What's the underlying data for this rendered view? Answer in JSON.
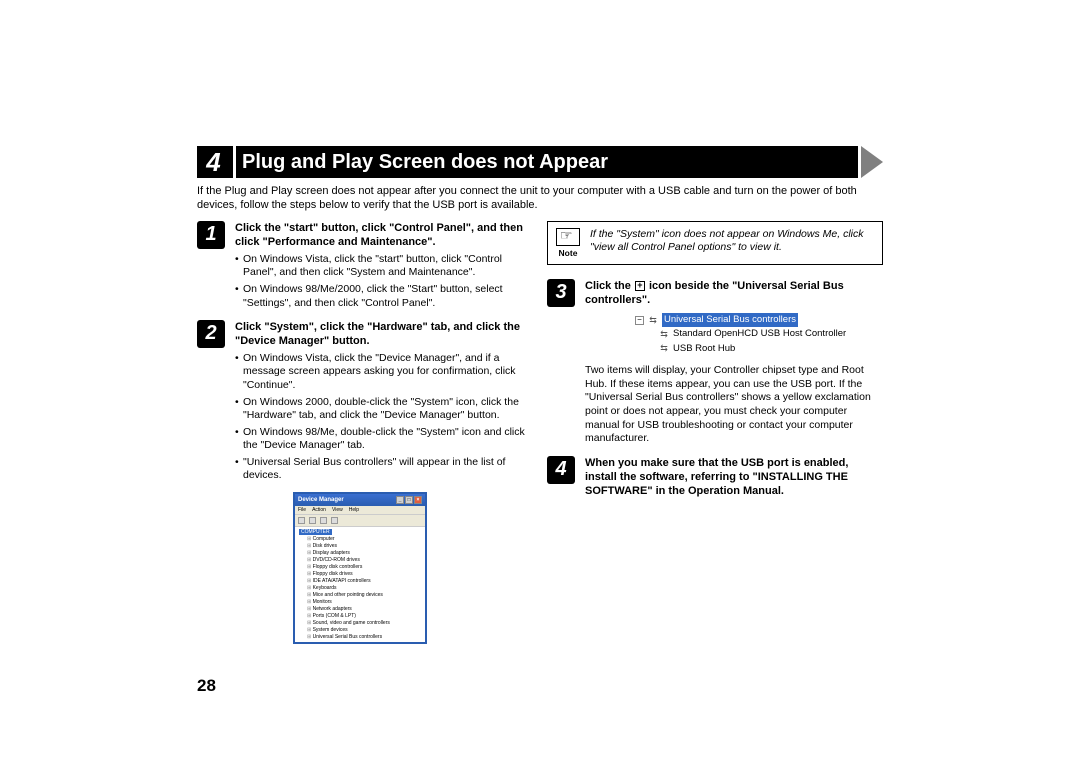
{
  "section_number": "4",
  "section_title": "Plug and Play Screen does not Appear",
  "intro": "If the Plug and Play screen does not appear after you connect the unit to your computer with a USB cable and turn on the power of both devices, follow the steps below to verify that the USB port is available.",
  "page_number": "28",
  "steps": {
    "s1": {
      "num": "1",
      "head": "Click the \"start\" button, click \"Control Panel\", and then click \"Performance and Maintenance\".",
      "bullets": [
        "On Windows Vista, click the \"start\" button, click \"Control Panel\", and then click \"System and Maintenance\".",
        "On Windows 98/Me/2000, click the \"Start\" button, select \"Settings\", and then click \"Control Panel\"."
      ]
    },
    "s2": {
      "num": "2",
      "head": "Click \"System\", click the \"Hardware\" tab, and click the \"Device Manager\" button.",
      "bullets": [
        "On Windows Vista, click the \"Device Manager\", and if a message screen appears asking you for confirmation, click \"Continue\".",
        "On Windows 2000, double-click the \"System\" icon, click the \"Hardware\" tab, and click the \"Device Manager\" button.",
        "On Windows 98/Me, double-click the \"System\" icon and click the \"Device Manager\" tab.",
        "\"Universal Serial Bus controllers\" will appear in the list of devices."
      ]
    },
    "s3": {
      "num": "3",
      "head_prefix": "Click the ",
      "head_suffix": " icon beside the \"Universal Serial Bus controllers\".",
      "body": "Two items will display, your Controller chipset type and Root Hub. If these items appear, you can use the USB port. If the \"Universal Serial Bus controllers\" shows a yellow exclamation point or does not appear, you must check your computer manual for USB troubleshooting or contact your computer manufacturer."
    },
    "s4": {
      "num": "4",
      "head": "When you make sure that the USB port is enabled, install the software, referring to \"INSTALLING THE SOFTWARE\" in the Operation Manual."
    }
  },
  "note": {
    "label": "Note",
    "text": "If the \"System\" icon does not appear on Windows Me, click \"view all Control Panel options\" to view it."
  },
  "device_manager": {
    "title": "Device Manager",
    "menu": [
      "File",
      "Action",
      "View",
      "Help"
    ],
    "root": "COMPUTER",
    "items": [
      "Computer",
      "Disk drives",
      "Display adapters",
      "DVD/CD-ROM drives",
      "Floppy disk controllers",
      "Floppy disk drives",
      "IDE ATA/ATAPI controllers",
      "Keyboards",
      "Mice and other pointing devices",
      "Monitors",
      "Network adapters",
      "Ports (COM & LPT)",
      "Sound, video and game controllers",
      "System devices",
      "Universal Serial Bus controllers"
    ]
  },
  "usb_tree": {
    "parent": "Universal Serial Bus controllers",
    "children": [
      "Standard OpenHCD USB Host Controller",
      "USB Root Hub"
    ]
  }
}
